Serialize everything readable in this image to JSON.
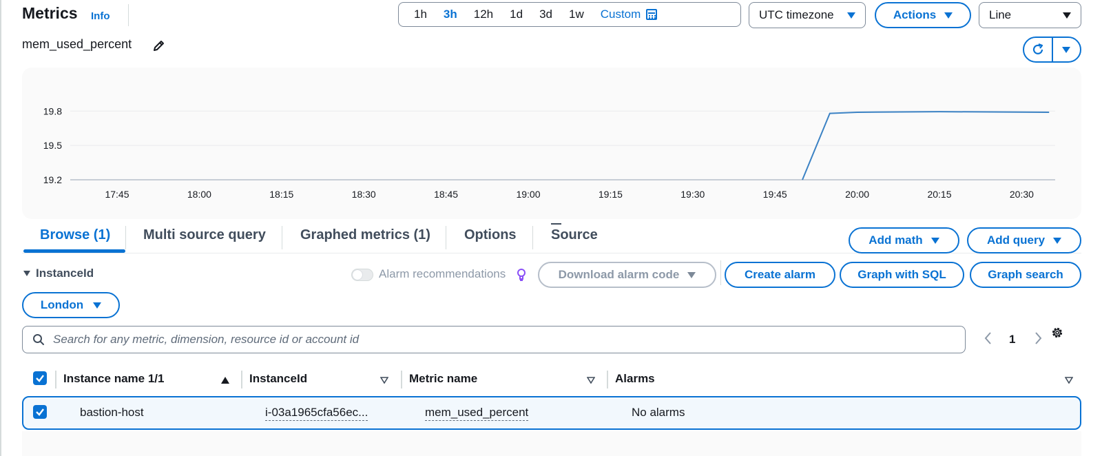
{
  "header": {
    "title": "Metrics",
    "info_label": "Info",
    "time_ranges": [
      {
        "label": "1h",
        "active": false
      },
      {
        "label": "3h",
        "active": true
      },
      {
        "label": "12h",
        "active": false
      },
      {
        "label": "1d",
        "active": false
      },
      {
        "label": "3d",
        "active": false
      },
      {
        "label": "1w",
        "active": false
      }
    ],
    "custom_label": "Custom",
    "timezone_label": "UTC timezone",
    "actions_label": "Actions",
    "chart_type_label": "Line"
  },
  "metric": {
    "title": "mem_used_percent"
  },
  "chart_data": {
    "type": "line",
    "x_ticks": [
      "17:45",
      "18:00",
      "18:15",
      "18:30",
      "18:45",
      "19:00",
      "19:15",
      "19:30",
      "19:45",
      "20:00",
      "20:15",
      "20:30"
    ],
    "y_ticks": [
      19.2,
      19.5,
      19.8
    ],
    "ylim": [
      19.2,
      19.85
    ],
    "grid": true,
    "series": [
      {
        "color": "#3b82c4",
        "x": [
          "19:50",
          "19:55",
          "20:00",
          "20:15",
          "20:35"
        ],
        "values": [
          19.2,
          19.78,
          19.79,
          19.795,
          19.79
        ]
      }
    ]
  },
  "tabs": [
    {
      "label": "Browse (1)",
      "active": true
    },
    {
      "label": "Multi source query",
      "active": false
    },
    {
      "label": "Graphed metrics (1)",
      "active": false
    },
    {
      "label": "Options",
      "active": false
    },
    {
      "label": "Source",
      "active": false
    }
  ],
  "toolbar": {
    "add_math_label": "Add math",
    "add_query_label": "Add query",
    "alarm_recommendations_label": "Alarm recommendations",
    "download_alarm_code_label": "Download alarm code",
    "create_alarm_label": "Create alarm",
    "graph_with_sql_label": "Graph with SQL",
    "graph_search_label": "Graph search"
  },
  "filter": {
    "dimension_label": "InstanceId",
    "region_label": "London"
  },
  "search": {
    "placeholder": "Search for any metric, dimension, resource id or account id",
    "value": ""
  },
  "pagination": {
    "current_page": "1"
  },
  "table": {
    "columns": [
      "Instance name 1/1",
      "InstanceId",
      "Metric name",
      "Alarms"
    ],
    "rows": [
      {
        "selected": true,
        "instance_name": "bastion-host",
        "instance_id": "i-03a1965cfa56ec...",
        "metric_name": "mem_used_percent",
        "alarms": "No alarms"
      }
    ]
  },
  "colors": {
    "accent": "#0972d3",
    "line": "#3b82c4",
    "bulb": "#8a4ff7"
  }
}
